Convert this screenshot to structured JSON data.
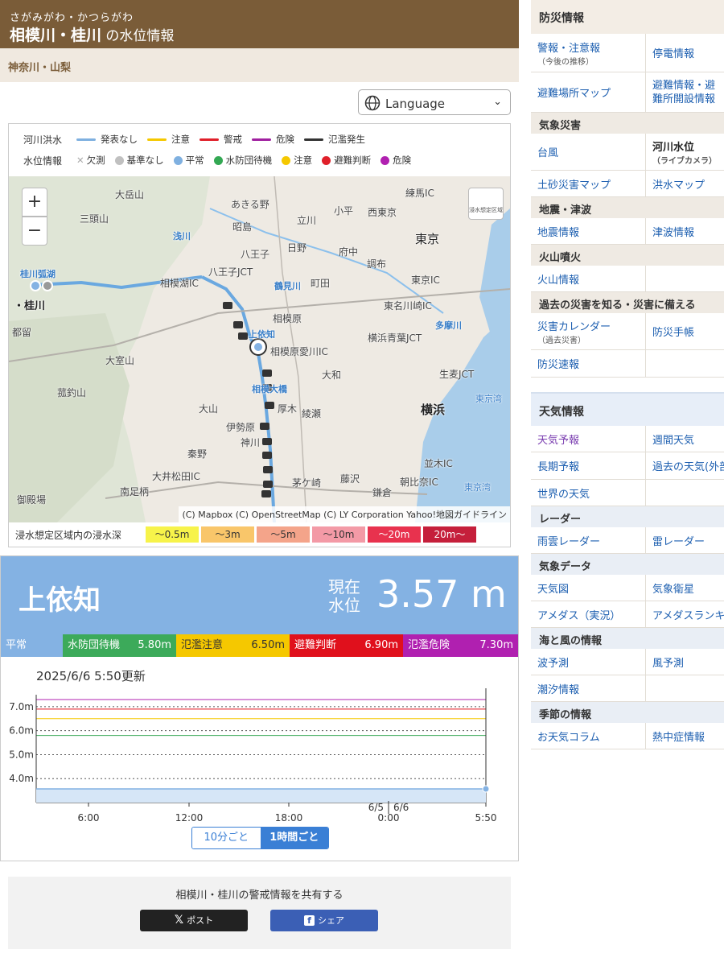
{
  "header": {
    "kana": "さがみがわ・かつらがわ",
    "title_main": "相模川・桂川",
    "title_suffix": "の水位情報",
    "prefectures": "神奈川・山梨"
  },
  "language": {
    "label": "Language"
  },
  "legend": {
    "flood_label": "河川洪水",
    "flood_items": [
      {
        "label": "発表なし",
        "color": "#7fb0e0"
      },
      {
        "label": "注意",
        "color": "#f5c800"
      },
      {
        "label": "警戒",
        "color": "#e0202a"
      },
      {
        "label": "危険",
        "color": "#a020a0"
      },
      {
        "label": "氾濫発生",
        "color": "#333333"
      }
    ],
    "level_label": "水位情報",
    "level_items": [
      {
        "label": "欠測",
        "color": "#aaaaaa"
      },
      {
        "label": "基準なし",
        "color": "#c0c0c0"
      },
      {
        "label": "平常",
        "color": "#7fb0e0"
      },
      {
        "label": "水防団待機",
        "color": "#33a853"
      },
      {
        "label": "注意",
        "color": "#f5c800"
      },
      {
        "label": "避難判断",
        "color": "#e0202a"
      },
      {
        "label": "危険",
        "color": "#b020b0"
      }
    ]
  },
  "map": {
    "labels": {
      "sanno": "三頭山",
      "otake": "大岳山",
      "akiruno": "あきる野",
      "tachikawa": "立川",
      "kodaira": "小平",
      "nishitokyo": "西東京",
      "nerima": "練馬IC",
      "asakawa": "浅川",
      "showa": "昭島",
      "hino": "日野",
      "fuchu": "府中",
      "hachioji": "八王子",
      "tokyo": "東京",
      "katsuragawa_weir": "桂川弧湖",
      "hachioji_jct": "八王子JCT",
      "chofu": "調布",
      "sagamiko": "相模湖IC",
      "tsurumigawa": "鶴見川",
      "machida": "町田",
      "tokyo_ic": "東京IC",
      "katsuragawa": "・桂川",
      "tsuru": "都留",
      "sagamihara": "相模原",
      "higashikawasaki": "東名川崎IC",
      "tamagawa": "多摩川",
      "kamiyochi": "上依知",
      "sagamiharaaikawa": "相模原愛川IC",
      "yokohamaaoba": "横浜青葉JCT",
      "odake": "大室山",
      "yamato": "大和",
      "namamugi": "生麦JCT",
      "sagamiohashi": "相模大橋",
      "tsurugiyama": "菰釣山",
      "oyama": "大山",
      "atsugi": "厚木",
      "ayase": "綾瀬",
      "yokohama": "横浜",
      "tokyobay": "東京湾",
      "isehara": "伊勢原",
      "kanagawa": "神川",
      "hadano": "秦野",
      "oimatsuda": "大井松田IC",
      "chigasaki": "茅ケ崎",
      "fujisawa": "藤沢",
      "asahina": "朝比奈IC",
      "namiki": "並木IC",
      "minamiashigara": "南足柄",
      "gotenba": "御殿場",
      "kamakura": "鎌倉",
      "tokyowan2": "東京湾",
      "flood_zone": "浸水想定区域"
    },
    "attribution": "(C) Mapbox (C) OpenStreetMap (C) LY Corporation Yahoo!地図ガイドライン",
    "depth_label": "浸水想定区域内の浸水深",
    "depth_items": [
      {
        "label": "〜0.5m",
        "color": "#f7f34a"
      },
      {
        "label": "〜3m",
        "color": "#f9c66a"
      },
      {
        "label": "〜5m",
        "color": "#f4a48a"
      },
      {
        "label": "〜10m",
        "color": "#f39aa6"
      },
      {
        "label": "〜20m",
        "color": "#e8324e"
      },
      {
        "label": "20m〜",
        "color": "#c51f3b"
      }
    ]
  },
  "station": {
    "name": "上依知",
    "current_label": "現在水位",
    "current_value": "3.57 m",
    "levels": [
      {
        "label": "平常",
        "value": "",
        "color": "#84b2e3",
        "text": "#ffffff"
      },
      {
        "label": "水防団待機",
        "value": "5.80m",
        "color": "#3caa5a",
        "text": "#ffffff"
      },
      {
        "label": "氾濫注意",
        "value": "6.50m",
        "color": "#f5c800",
        "text": "#333333"
      },
      {
        "label": "避難判断",
        "value": "6.90m",
        "color": "#e0101c",
        "text": "#ffffff"
      },
      {
        "label": "氾濫危険",
        "value": "7.30m",
        "color": "#b020b0",
        "text": "#ffffff"
      }
    ],
    "updated": "2025/6/6 5:50更新",
    "tab_10min": "10分ごと",
    "tab_1hour": "1時間ごと"
  },
  "chart_data": {
    "type": "area",
    "x": [
      "6:00",
      "12:00",
      "18:00",
      "0:00",
      "5:50"
    ],
    "x_ticks": [
      "6:00",
      "12:00",
      "18:00",
      "6/5 6/6 0:00",
      "5:50"
    ],
    "date_labels": [
      "6/5",
      "6/6"
    ],
    "y_ticks": [
      "4.0m",
      "5.0m",
      "6.0m",
      "7.0m"
    ],
    "ylim": [
      3.0,
      7.5
    ],
    "series": [
      {
        "values": [
          3.57,
          3.57,
          3.57,
          3.57,
          3.57
        ]
      }
    ],
    "thresholds": [
      {
        "value": 5.8,
        "color": "#3caa5a"
      },
      {
        "value": 6.5,
        "color": "#f5c800"
      },
      {
        "value": 6.9,
        "color": "#e0101c"
      },
      {
        "value": 7.3,
        "color": "#b020b0"
      }
    ]
  },
  "share": {
    "text": "相模川・桂川の警戒情報を共有する",
    "x_label": "ポスト",
    "fb_label": "シェア"
  },
  "sidebar": {
    "disaster_head": "防災情報",
    "r1a": "警報・注意報",
    "r1a_sub": "（今後の推移）",
    "r1b": "停電情報",
    "r2a": "避難場所マップ",
    "r2b": "避難情報・避難所開設情報",
    "weather_disaster": "気象災害",
    "r3a": "台風",
    "r3b": "河川水位",
    "r3b_sub": "（ライブカメラ）",
    "r4a": "土砂災害マップ",
    "r4b": "洪水マップ",
    "quake_head": "地震・津波",
    "r5a": "地震情報",
    "r5b": "津波情報",
    "volcano_head": "火山噴火",
    "r6a": "火山情報",
    "past_head": "過去の災害を知る・災害に備える",
    "r7a": "災害カレンダー",
    "r7a_sub": "（過去災害）",
    "r7b": "防災手帳",
    "r8a": "防災速報",
    "weather_head": "天気情報",
    "w1a": "天気予報",
    "w1b": "週間天気",
    "w2a": "長期予報",
    "w2b": "過去の天気(外部サイト)",
    "w3a": "世界の天気",
    "radar_head": "レーダー",
    "w4a": "雨雲レーダー",
    "w4b": "雷レーダー",
    "data_head": "気象データ",
    "w5a": "天気図",
    "w5b": "気象衛星",
    "w6a": "アメダス（実況）",
    "w6b": "アメダスランキング",
    "sea_head": "海と風の情報",
    "w7a": "波予測",
    "w7b": "風予測",
    "w8a": "潮汐情報",
    "season_head": "季節の情報",
    "w9a": "お天気コラム",
    "w9b": "熱中症情報"
  }
}
